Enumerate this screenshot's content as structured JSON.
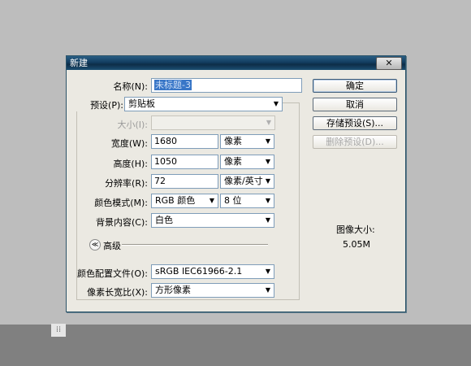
{
  "window": {
    "title": "新建",
    "close_glyph": "✕"
  },
  "fields": {
    "name": {
      "label": "名称(N):",
      "value": "未标题-3"
    },
    "preset": {
      "label": "预设(P):",
      "value": "剪贴板"
    },
    "size": {
      "label": "大小(I):",
      "value": ""
    },
    "width": {
      "label": "宽度(W):",
      "value": "1680",
      "unit": "像素"
    },
    "height": {
      "label": "高度(H):",
      "value": "1050",
      "unit": "像素"
    },
    "resolution": {
      "label": "分辨率(R):",
      "value": "72",
      "unit": "像素/英寸"
    },
    "color_mode": {
      "label": "颜色模式(M):",
      "value": "RGB 颜色",
      "bits": "8 位"
    },
    "background": {
      "label": "背景内容(C):",
      "value": "白色"
    },
    "advanced": {
      "label": "高级"
    },
    "color_profile": {
      "label": "颜色配置文件(O):",
      "value": "sRGB IEC61966-2.1"
    },
    "pixel_aspect": {
      "label": "像素长宽比(X):",
      "value": "方形像素"
    }
  },
  "buttons": {
    "ok": "确定",
    "cancel": "取消",
    "save_preset": "存储预设(S)...",
    "delete_preset": "删除预设(D)..."
  },
  "info": {
    "label": "图像大小:",
    "value": "5.05M"
  },
  "icons": {
    "dropdown": "▼",
    "collapse": "≪",
    "grip": "⁞⁞"
  }
}
